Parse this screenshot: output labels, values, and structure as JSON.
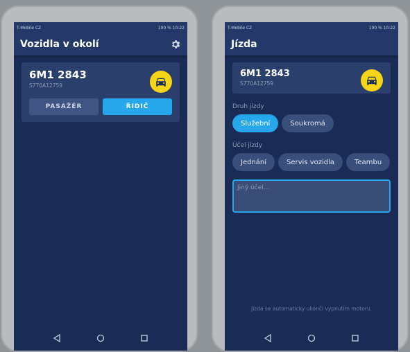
{
  "status_bar": {
    "carrier": "T-Mobile CZ",
    "indicators": "100 %",
    "time": "10:22"
  },
  "screen1": {
    "title": "Vozidla v okolí",
    "vehicle": {
      "plate": "6M1 2843",
      "vin": "S770A12759"
    },
    "passenger_label": "PASAŽÉR",
    "driver_label": "ŘIDIČ"
  },
  "screen2": {
    "title": "Jízda",
    "vehicle": {
      "plate": "6M1 2843",
      "vin": "S770A12759"
    },
    "trip_type_label": "Druh jízdy",
    "trip_types": [
      "Služební",
      "Soukromá"
    ],
    "purpose_label": "Účel jízdy",
    "purposes": [
      "Jednání",
      "Servis vozidla",
      "Teambu"
    ],
    "other_placeholder": "Jiný účel...",
    "footer_note": "Jízda se automaticky ukončí vypnutím motoru."
  },
  "icons": {
    "settings": "gear-icon",
    "car": "car-icon",
    "nav_back": "triangle-back-icon",
    "nav_home": "circle-home-icon",
    "nav_recents": "square-recents-icon"
  },
  "colors": {
    "background": "#1a2b55",
    "app_bar": "#24396a",
    "card": "#2b3f6c",
    "accent": "#27a7eb",
    "badge": "#f7d417"
  }
}
